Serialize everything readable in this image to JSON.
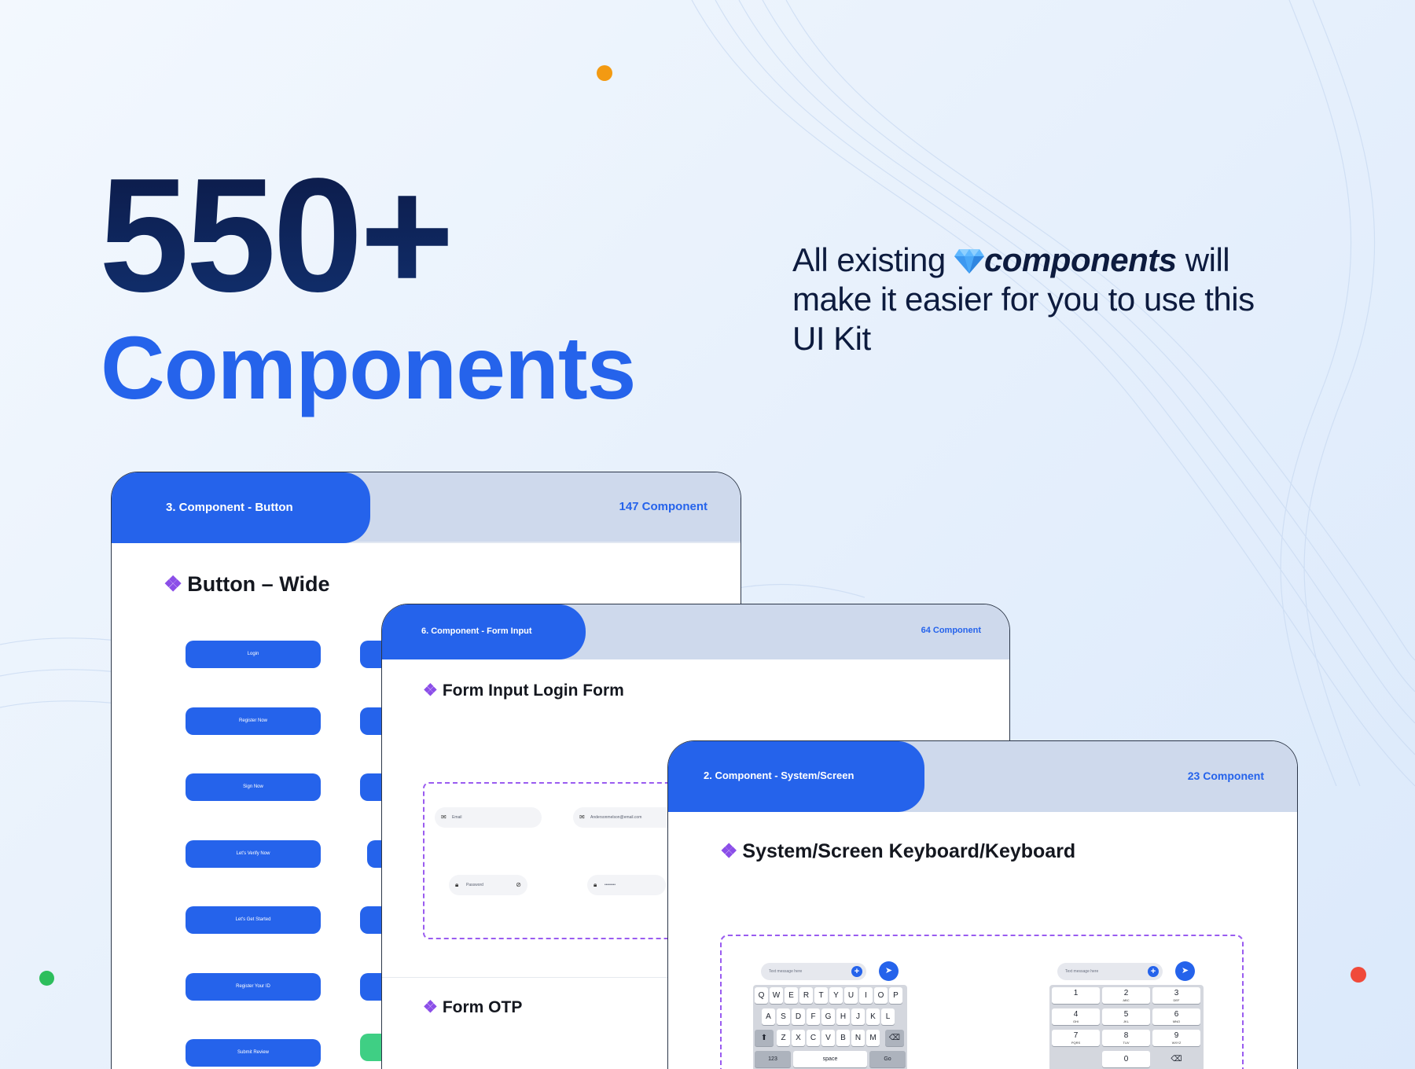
{
  "hero": {
    "number": "550+",
    "word": "Components"
  },
  "tagline": {
    "prefix": "All existing",
    "emphasis": "components",
    "suffix": "will make it easier for you to use this UI Kit",
    "icon": "diamond-gem-icon"
  },
  "colors": {
    "accent": "#2563eb",
    "navy": "#0c1a47",
    "header_tab_bg": "#ced9ec",
    "dashed_frame": "#9a5cf0",
    "dot_orange": "#f39a12",
    "dot_green": "#2dbe5c",
    "dot_red": "#f04a3a"
  },
  "cards": {
    "button": {
      "tab": "3. Component - Button",
      "count": "147 Component",
      "section_icon": "❖",
      "section_title": "Button – Wide",
      "buttons": [
        "Login",
        "Register Now",
        "Sign Now",
        "Let's Verify Now",
        "Let's Get Started",
        "Register Your ID",
        "Submit Review"
      ]
    },
    "form": {
      "tab": "6. Component - Form Input",
      "count": "64 Component",
      "section_icon": "❖",
      "section_title": "Form Input Login Form",
      "section_title_2": "Form OTP",
      "email_placeholder": "Email",
      "email_value": "Andersonmelson@email.com",
      "password_placeholder": "Password",
      "password_value": "••••••••"
    },
    "keyboard": {
      "tab": "2. Component - System/Screen",
      "count": "23 Component",
      "section_icon": "❖",
      "section_title": "System/Screen Keyboard/Keyboard",
      "message_placeholder": "Text message here",
      "row1": [
        "Q",
        "W",
        "E",
        "R",
        "T",
        "Y",
        "U",
        "I",
        "O",
        "P"
      ],
      "row2": [
        "A",
        "S",
        "D",
        "F",
        "G",
        "H",
        "J",
        "K",
        "L"
      ],
      "row3": [
        "Z",
        "X",
        "C",
        "V",
        "B",
        "N",
        "M"
      ],
      "shift": "⬆",
      "backspace": "⌫",
      "key_123": "123",
      "key_space": "space",
      "key_go": "Go",
      "numpad": [
        {
          "n": "1",
          "l": ""
        },
        {
          "n": "2",
          "l": "ABC"
        },
        {
          "n": "3",
          "l": "DEF"
        },
        {
          "n": "4",
          "l": "GHI"
        },
        {
          "n": "5",
          "l": "JKL"
        },
        {
          "n": "6",
          "l": "MNO"
        },
        {
          "n": "7",
          "l": "PQRS"
        },
        {
          "n": "8",
          "l": "TUV"
        },
        {
          "n": "9",
          "l": "WXYZ"
        }
      ],
      "num_zero": "0"
    }
  }
}
